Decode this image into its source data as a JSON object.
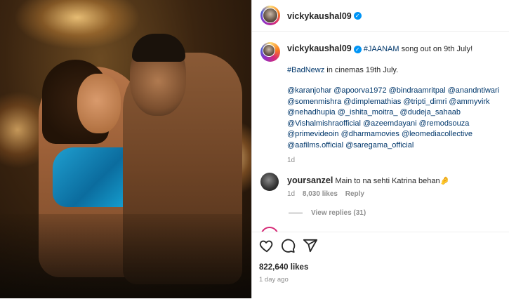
{
  "post": {
    "header_username": "vickykaushal09",
    "caption_username": "vickykaushal09",
    "caption_hashtag": "#JAANAM",
    "caption_line1_rest": " song out on 9th July!",
    "caption_hashtag2": "#BadNewz",
    "caption_line2_rest": " in cinemas 19th July.",
    "mentions": "@karanjohar @apoorva1972 @bindraamritpal @anandntiwari @somenmishra @dimplemathias @tripti_dimri @ammyvirk @nehadhupia @_ishita_moitra_ @dudeja_sahaab @Vishalmishraofficial @azeemdayani @remodsouza @primevideoin @dharmamovies @leomediacollective @aafilms.official @saregama_official",
    "caption_age": "1d",
    "likes": "822,640 likes",
    "posted": "1 day ago"
  },
  "comment": {
    "username": "yoursanzel",
    "text": " Main to na sehti Katrina behan🤌",
    "age": "1d",
    "likes": "8,030 likes",
    "reply_label": "Reply",
    "view_replies": "View replies (31)"
  },
  "icons": {
    "like": "heart-icon",
    "comment": "comment-icon",
    "share": "share-icon",
    "verified": "verified-badge-icon"
  },
  "colors": {
    "link": "#00376b",
    "verified": "#0095f6",
    "muted": "#8e8e8e"
  }
}
